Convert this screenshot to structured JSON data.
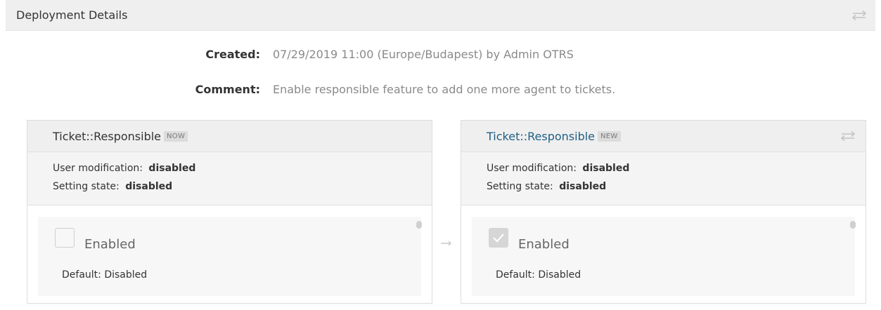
{
  "header": {
    "title": "Deployment Details",
    "icon": "swap-icon"
  },
  "meta": {
    "created_label": "Created:",
    "created_value": "07/29/2019 11:00 (Europe/Budapest) by Admin OTRS",
    "comment_label": "Comment:",
    "comment_value": "Enable responsible feature to add one more agent to tickets."
  },
  "cards": {
    "left": {
      "title": "Ticket::Responsible",
      "badge": "NOW",
      "user_mod_label": "User modification:",
      "user_mod_value": "disabled",
      "state_label": "Setting state:",
      "state_value": "disabled",
      "checkbox_checked": false,
      "checkbox_label": "Enabled",
      "default_text": "Default: Disabled"
    },
    "right": {
      "title": "Ticket::Responsible",
      "badge": "NEW",
      "icon": "swap-icon",
      "user_mod_label": "User modification:",
      "user_mod_value": "disabled",
      "state_label": "Setting state:",
      "state_value": "disabled",
      "checkbox_checked": true,
      "checkbox_label": "Enabled",
      "default_text": "Default: Disabled"
    }
  },
  "colors": {
    "header_bg": "#efefef",
    "link": "#1f5f85",
    "muted_text": "#8a8a8a",
    "badge_bg": "#dcdcdc"
  }
}
